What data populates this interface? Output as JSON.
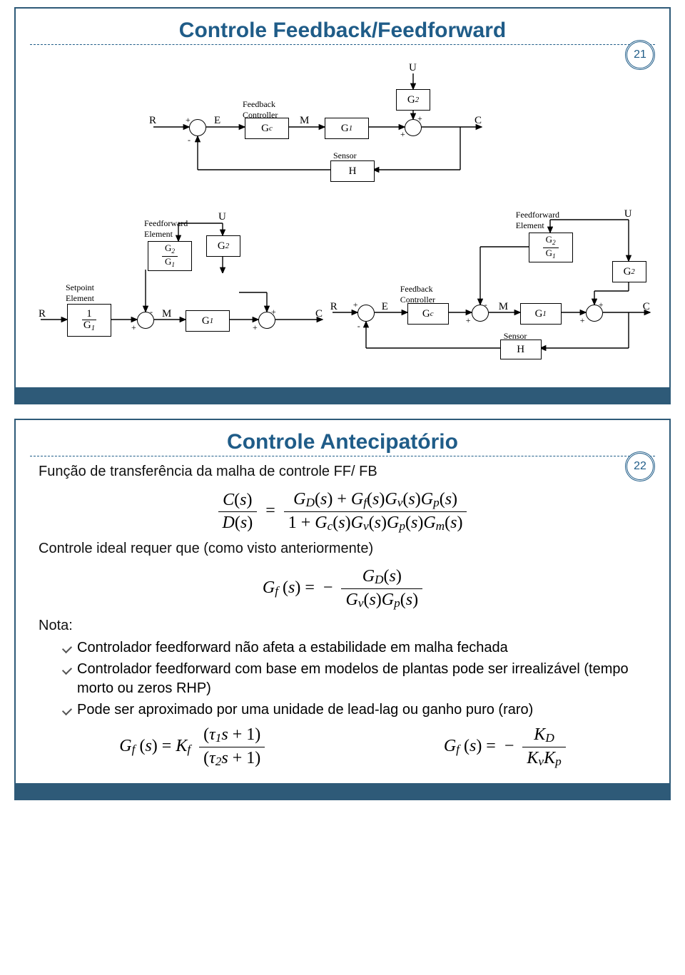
{
  "slide1": {
    "title": "Controle Feedback/Feedforward",
    "page": "21",
    "diagram1": {
      "labels": {
        "R": "R",
        "E": "E",
        "M": "M",
        "C": "C",
        "U": "U",
        "plus": "+",
        "minus": "-"
      },
      "blocks": {
        "fb_ctrl_caption": "Feedback\nController",
        "Gc": "G",
        "Gc_sub": "c",
        "G1": "G",
        "G1_sub": "1",
        "G2": "G",
        "G2_sub": "2",
        "sensor": "Sensor",
        "H": "H"
      }
    },
    "diagram2": {
      "labels": {
        "R": "R",
        "M": "M",
        "C": "C",
        "U": "U",
        "plus": "+",
        "minus": "-"
      },
      "blocks": {
        "setpt_el": "Setpoint\nElement",
        "ff_el": "Feedforward\nElement",
        "one": "1",
        "G1": "G",
        "G1_sub": "1",
        "G2": "G",
        "G2_sub": "2"
      }
    },
    "diagram3": {
      "labels": {
        "R": "R",
        "E": "E",
        "M": "M",
        "C": "C",
        "U": "U",
        "plus": "+",
        "minus": "-"
      },
      "blocks": {
        "fb_ctrl_caption": "Feedback\nController",
        "ff_el": "Feedforward\nElement",
        "Gc": "G",
        "Gc_sub": "c",
        "G1": "G",
        "G1_sub": "1",
        "G2": "G",
        "G2_sub": "2",
        "sensor": "Sensor",
        "H": "H"
      }
    }
  },
  "slide2": {
    "title": "Controle Antecipatório",
    "page": "22",
    "text": {
      "l1": "Função de transferência da malha de controle FF/ FB",
      "l2": "Controle ideal requer que (como visto anteriormente)",
      "nota": "Nota:",
      "b1": "Controlador feedforward não afeta a estabilidade em malha fechada",
      "b2": "Controlador feedforward com base em modelos de plantas pode ser irrealizável (tempo morto ou zeros RHP)",
      "b3": "Pode ser aproximado por uma unidade de lead-lag ou ganho puro (raro)"
    },
    "eq1": {
      "lhs_num": "C(s)",
      "lhs_den": "D(s)",
      "rhs_num": "G_D(s) + G_f(s)G_v(s)G_p(s)",
      "rhs_den": "1 + G_c(s)G_v(s)G_p(s)G_m(s)"
    },
    "eq2": {
      "lhs": "G_f(s)",
      "rhs_num": "G_D(s)",
      "rhs_den": "G_v(s)G_p(s)"
    },
    "eq3a": {
      "lhs": "G_f(s)",
      "K": "K_f",
      "num": "(τ₁s + 1)",
      "den": "(τ₂s + 1)"
    },
    "eq3b": {
      "lhs": "G_f(s)",
      "num": "K_D",
      "den": "K_v K_p"
    }
  }
}
